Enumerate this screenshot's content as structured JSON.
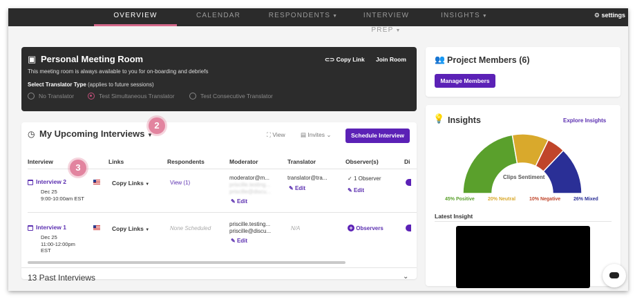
{
  "nav": {
    "tabs": [
      {
        "label": "OVERVIEW",
        "active": true
      },
      {
        "label": "CALENDAR"
      },
      {
        "label": "RESPONDENTS",
        "dropdown": true
      },
      {
        "label": "INTERVIEW PREP",
        "dropdown": true
      },
      {
        "label": "INSIGHTS",
        "dropdown": true
      }
    ],
    "settings": "settings"
  },
  "room": {
    "title": "Personal Meeting Room",
    "copy_link": "Copy Link",
    "join_room": "Join Room",
    "description": "This meeting room is always available to you for on-boarding and debriefs",
    "select_label": "Select Translator Type",
    "select_note": "(applies to future sessions)",
    "options": [
      "No Translator",
      "Test Simultaneous Translator",
      "Test Consecutive Translator"
    ],
    "selected_option": "Test Simultaneous Translator"
  },
  "upcoming": {
    "title": "My Upcoming Interviews",
    "view": "View",
    "invites": "Invites",
    "schedule_button": "Schedule Interview",
    "headers": [
      "Interview",
      "Links",
      "Respondents",
      "Moderator",
      "Translator",
      "Observer(s)",
      "Di"
    ],
    "rows": [
      {
        "name": "Interview 2",
        "date": "Dec 25",
        "time": "9:00-10:00am EST",
        "links": "Copy Links",
        "respondents": "View (1)",
        "moderator": "moderator@m...",
        "moderator_blur1": "priscille.testing...",
        "moderator_blur2": "priscille@discu...",
        "moderator_edit": "Edit",
        "translator": "translator@tra...",
        "translator_edit": "Edit",
        "observers": "1 Observer",
        "observers_edit": "Edit"
      },
      {
        "name": "Interview 1",
        "date": "Dec 25",
        "time": "11:00-12:00pm",
        "time2": "EST",
        "links": "Copy Links",
        "respondents": "None Scheduled",
        "moderator": "priscille.testing...",
        "moderator2": "priscille@discu...",
        "moderator_edit": "Edit",
        "translator": "N/A",
        "observers": "Observers"
      }
    ],
    "past": "13 Past Interviews",
    "badge_2": "2",
    "badge_3": "3"
  },
  "members": {
    "title": "Project Members (6)",
    "button": "Manage Members"
  },
  "insights": {
    "title": "Insights",
    "explore": "Explore Insights",
    "center_label": "Clips Sentiment",
    "latest": "Latest Insight",
    "legend": [
      {
        "label": "45% Positive",
        "color": "#5aa02c"
      },
      {
        "label": "20% Neutral",
        "color": "#d9a92c"
      },
      {
        "label": "10% Negative",
        "color": "#c0452a"
      },
      {
        "label": "26% Mixed",
        "color": "#2a2f96"
      }
    ]
  },
  "chart_data": {
    "type": "pie",
    "labels": [
      "Positive",
      "Neutral",
      "Negative",
      "Mixed"
    ],
    "values": [
      45,
      20,
      10,
      26
    ],
    "title": "Clips Sentiment"
  }
}
